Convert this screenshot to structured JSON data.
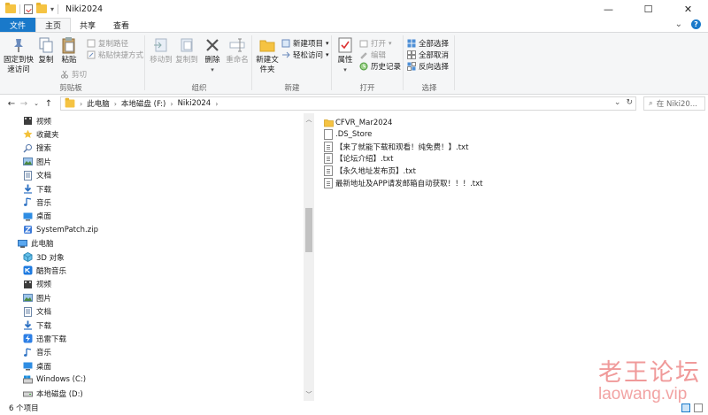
{
  "window": {
    "title": "Niki2024",
    "controls": {
      "minimize": "—",
      "maximize": "☐",
      "close": "✕"
    }
  },
  "ribbon_tabs": [
    "文件",
    "主页",
    "共享",
    "查看"
  ],
  "ribbon": {
    "clipboard": {
      "pin": "固定到快速访问",
      "copy": "复制",
      "paste": "粘贴",
      "copy_path": "复制路径",
      "paste_shortcut": "粘贴快捷方式",
      "cut": "剪切",
      "label": "剪贴板"
    },
    "organize": {
      "move_to": "移动到",
      "copy_to": "复制到",
      "delete": "删除",
      "rename": "重命名",
      "label": "组织"
    },
    "new": {
      "new_folder": "新建文件夹",
      "new_item": "新建项目",
      "easy_access": "轻松访问",
      "label": "新建"
    },
    "open": {
      "properties": "属性",
      "open": "打开",
      "edit": "编辑",
      "history": "历史记录",
      "label": "打开"
    },
    "select": {
      "select_all": "全部选择",
      "select_none": "全部取消",
      "invert": "反向选择",
      "label": "选择"
    }
  },
  "address": {
    "breadcrumb": [
      "此电脑",
      "本地磁盘 (F:)",
      "Niki2024"
    ],
    "search_placeholder": "在 Niki20..."
  },
  "nav_items": [
    {
      "label": "视频",
      "icon": "video-icon"
    },
    {
      "label": "收藏夹",
      "icon": "star-icon"
    },
    {
      "label": "搜索",
      "icon": "search-icon"
    },
    {
      "label": "图片",
      "icon": "pictures-icon"
    },
    {
      "label": "文档",
      "icon": "documents-icon"
    },
    {
      "label": "下载",
      "icon": "download-icon"
    },
    {
      "label": "音乐",
      "icon": "music-icon"
    },
    {
      "label": "桌面",
      "icon": "desktop-icon"
    },
    {
      "label": "SystemPatch.zip",
      "icon": "zip-icon"
    },
    {
      "label": "此电脑",
      "icon": "computer-icon"
    },
    {
      "label": "3D 对象",
      "icon": "3d-objects-icon"
    },
    {
      "label": "酷狗音乐",
      "icon": "kugou-icon"
    },
    {
      "label": "视频",
      "icon": "video-icon"
    },
    {
      "label": "图片",
      "icon": "pictures-icon"
    },
    {
      "label": "文档",
      "icon": "documents-icon"
    },
    {
      "label": "下载",
      "icon": "download-icon"
    },
    {
      "label": "迅雷下载",
      "icon": "thunder-icon"
    },
    {
      "label": "音乐",
      "icon": "music-icon"
    },
    {
      "label": "桌面",
      "icon": "desktop-icon"
    },
    {
      "label": "Windows (C:)",
      "icon": "drive-c-icon"
    },
    {
      "label": "本地磁盘 (D:)",
      "icon": "drive-icon"
    }
  ],
  "files": [
    {
      "name": "CFVR_Mar2024",
      "type": "folder"
    },
    {
      "name": ".DS_Store",
      "type": "file"
    },
    {
      "name": "【来了就能下载和观看！纯免费！】.txt",
      "type": "txt"
    },
    {
      "name": "【论坛介绍】.txt",
      "type": "txt"
    },
    {
      "name": "【永久地址发布页】.txt",
      "type": "txt"
    },
    {
      "name": "最新地址及APP请发邮箱自动获取！！！.txt",
      "type": "txt"
    }
  ],
  "status": {
    "item_count": "6 个项目"
  },
  "watermark": {
    "line1": "老王论坛",
    "line2": "laowang.vip"
  },
  "colors": {
    "accent": "#1979ca",
    "folder": "#f5c342",
    "watermark": "#f09a9a"
  }
}
